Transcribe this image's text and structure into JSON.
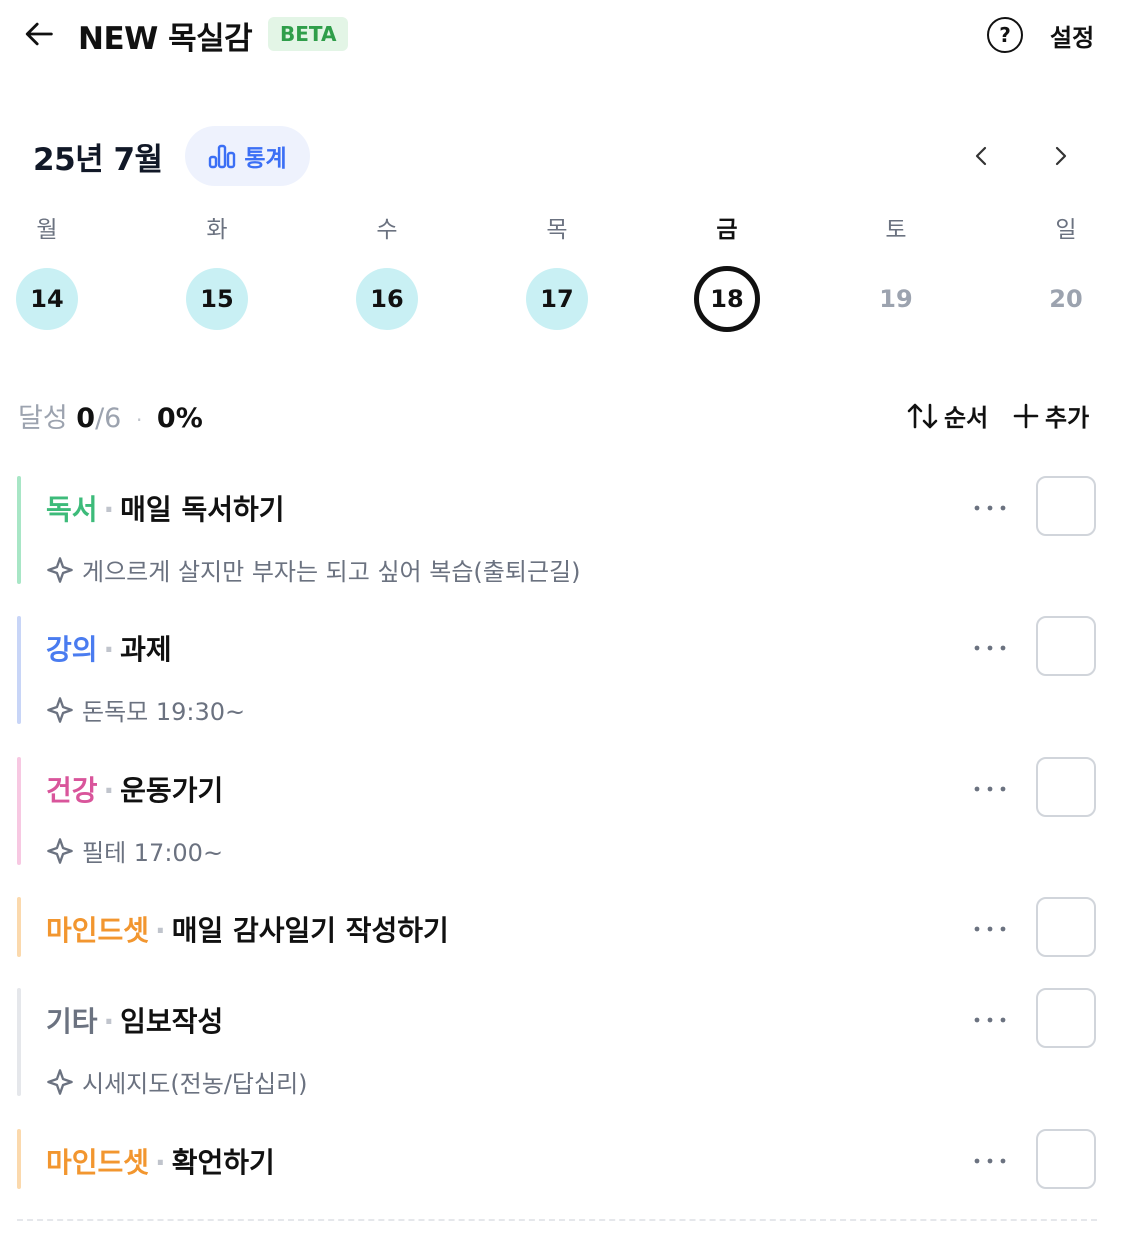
{
  "header": {
    "title": "NEW 목실감",
    "badge": "BETA",
    "settings_label": "설정"
  },
  "month": {
    "label": "25년 7월",
    "stats_label": "통계"
  },
  "week": {
    "days": [
      {
        "weekday": "월",
        "date": "14",
        "state": "done"
      },
      {
        "weekday": "화",
        "date": "15",
        "state": "done"
      },
      {
        "weekday": "수",
        "date": "16",
        "state": "done"
      },
      {
        "weekday": "목",
        "date": "17",
        "state": "done"
      },
      {
        "weekday": "금",
        "date": "18",
        "state": "today"
      },
      {
        "weekday": "토",
        "date": "19",
        "state": "future"
      },
      {
        "weekday": "일",
        "date": "20",
        "state": "future"
      }
    ]
  },
  "summary": {
    "label": "달성",
    "done": "0",
    "total": "/6",
    "percent": "0%",
    "order_label": "순서",
    "add_label": "추가"
  },
  "habits": [
    {
      "category": "독서",
      "name": "매일 독서하기",
      "note": "게으르게 살지만 부자는 되고 싶어 복습(출퇴근길)",
      "color": "#3dbb7a",
      "bar": "#a8e6c6"
    },
    {
      "category": "강의",
      "name": "과제",
      "note": "돈독모 19:30~",
      "color": "#4a7cf0",
      "bar": "#c8d5f7"
    },
    {
      "category": "건강",
      "name": "운동가기",
      "note": "필테 17:00~",
      "color": "#d9559b",
      "bar": "#f7c8e2"
    },
    {
      "category": "마인드셋",
      "name": "매일 감사일기 작성하기",
      "note": "",
      "color": "#f2962f",
      "bar": "#fbd9ad"
    },
    {
      "category": "기타",
      "name": "임보작성",
      "note": "시세지도(전농/답십리)",
      "color": "#6b7280",
      "bar": "#e5e7eb"
    },
    {
      "category": "마인드셋",
      "name": "확언하기",
      "note": "",
      "color": "#f2962f",
      "bar": "#fbd9ad"
    }
  ]
}
